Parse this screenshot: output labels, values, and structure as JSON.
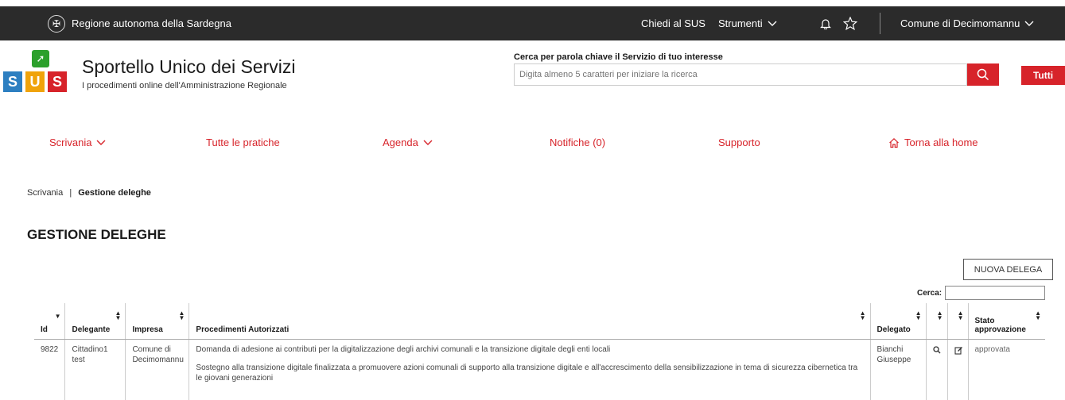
{
  "topbar": {
    "region": "Regione autonoma della Sardegna",
    "chiedi": "Chiedi al SUS",
    "strumenti": "Strumenti",
    "comune": "Comune di Decimomannu"
  },
  "header": {
    "logo_letters": [
      "S",
      "U",
      "S"
    ],
    "title": "Sportello Unico dei Servizi",
    "subtitle": "I procedimenti online dell'Amministrazione Regionale"
  },
  "search": {
    "label": "Cerca per parola chiave il Servizio di tuo interesse",
    "placeholder": "Digita almeno 5 caratteri per iniziare la ricerca",
    "filter_label": "Tutti"
  },
  "nav": {
    "scrivania": "Scrivania",
    "pratiche": "Tutte le pratiche",
    "agenda": "Agenda",
    "notifiche": "Notifiche (0)",
    "supporto": "Supporto",
    "home": "Torna alla home"
  },
  "breadcrumb": {
    "parent": "Scrivania",
    "separator": "|",
    "current": "Gestione deleghe"
  },
  "page": {
    "title": "GESTIONE DELEGHE",
    "new_button": "NUOVA DELEGA",
    "cerca_label": "Cerca:"
  },
  "table": {
    "headers": {
      "id": "Id",
      "delegante": "Delegante",
      "impresa": "Impresa",
      "procedimenti": "Procedimenti Autorizzati",
      "delegato": "Delegato",
      "stato": "Stato approvazione"
    },
    "rows": [
      {
        "id": "9822",
        "delegante": "Cittadino1 test",
        "impresa": "Comune di Decimomannu",
        "procedimenti": [
          "Domanda di adesione ai contributi per la digitalizzazione degli archivi comunali e la transizione digitale degli enti locali",
          "Sostegno alla transizione digitale finalizzata a promuovere azioni comunali di supporto alla transizione digitale e all'accrescimento della sensibilizzazione in tema di sicurezza cibernetica tra le giovani generazioni"
        ],
        "delegato": "Bianchi Giuseppe",
        "stato": "approvata"
      }
    ]
  },
  "colors": {
    "accent": "#d7232a",
    "topbar": "#2b2b2b"
  },
  "icons": [
    "emblem-icon",
    "chevron-down-icon",
    "bell-icon",
    "star-icon",
    "search-icon",
    "home-icon",
    "sort-icon",
    "view-icon",
    "edit-icon"
  ]
}
